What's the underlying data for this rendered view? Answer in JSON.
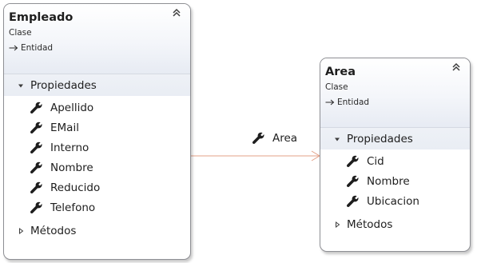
{
  "classes": [
    {
      "name": "Empleado",
      "stereotype": "Clase",
      "base": "Entidad",
      "sections": {
        "properties": "Propiedades",
        "methods": "Métodos"
      },
      "properties": [
        "Apellido",
        "EMail",
        "Interno",
        "Nombre",
        "Reducido",
        "Telefono"
      ]
    },
    {
      "name": "Area",
      "stereotype": "Clase",
      "base": "Entidad",
      "sections": {
        "properties": "Propiedades",
        "methods": "Métodos"
      },
      "properties": [
        "Cid",
        "Nombre",
        "Ubicacion"
      ]
    }
  ],
  "association": {
    "label": "Area"
  },
  "colors": {
    "connector": "#e3a087",
    "border": "#8e8f94"
  },
  "icons": {
    "property": "wrench-icon",
    "collapse": "double-chevron-up-icon",
    "base": "inheritance-arrow-icon",
    "section_expanded": "triangle-down-icon",
    "section_collapsed": "triangle-right-icon"
  }
}
